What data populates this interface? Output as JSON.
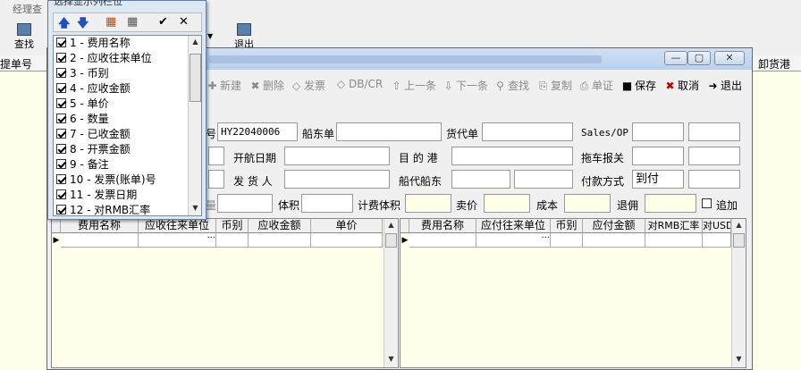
{
  "background": {
    "menu_label": "经理查",
    "toolbar": [
      {
        "label": "查找",
        "icon": "binoculars-icon"
      },
      {
        "label": "退出",
        "icon": "exit-door-icon"
      }
    ],
    "column_headers": [
      "提单号",
      "卸货港"
    ]
  },
  "popup": {
    "title": "选择显示列栏位",
    "toolbar_icons": [
      "move-up-icon",
      "move-down-icon",
      "palette-icon",
      "grid-icon",
      "ok-icon",
      "close-icon"
    ],
    "glyphs": {
      "up": "🡅",
      "down": "🡇",
      "palette": "▦",
      "grid": "▦",
      "ok": "✔",
      "close": "✕"
    },
    "items": [
      "1 - 费用名称",
      "2 - 应收往来单位",
      "3 - 币别",
      "4 - 应收金额",
      "5 - 单价",
      "6 - 数量",
      "7 - 已收金额",
      "8 - 开票金额",
      "9 - 备注",
      "10 - 发票(账单)号",
      "11 - 发票日期",
      "12 - 对RMB汇率"
    ]
  },
  "window": {
    "controls": {
      "minimize": "—",
      "maximize": "▢",
      "close": "✕"
    },
    "toolbar": [
      {
        "label": "新建",
        "glyph": "✚",
        "enabled": false
      },
      {
        "label": "删除",
        "glyph": "✖",
        "enabled": false
      },
      {
        "label": "发票",
        "glyph": "◇",
        "enabled": false
      },
      {
        "label": "DB/CR",
        "glyph": "◇",
        "enabled": false
      },
      {
        "label": "上一条",
        "glyph": "⇧",
        "enabled": false
      },
      {
        "label": "下一条",
        "glyph": "⇩",
        "enabled": false
      },
      {
        "label": "查找",
        "glyph": "⚲",
        "enabled": false
      },
      {
        "label": "复制",
        "glyph": "⎘",
        "enabled": false
      },
      {
        "label": "单证",
        "glyph": "⎙",
        "enabled": false
      },
      {
        "label": "保存",
        "glyph": "■",
        "enabled": true
      },
      {
        "label": "取消",
        "glyph": "✖",
        "enabled": true
      },
      {
        "label": "退出",
        "glyph": "➜",
        "enabled": true
      }
    ],
    "form": {
      "row1": {
        "id_label_tail": "号",
        "id_value": "HY22040006",
        "ship_order_label": "船东单",
        "ship_order_value": "",
        "forwarder_label": "货代单",
        "forwarder_value": "",
        "salesop_label": "Sales/OP",
        "salesop_value1": "",
        "salesop_value2": ""
      },
      "row2": {
        "sail_date_label": "开航日期",
        "sail_date_value": "",
        "dest_port_label": "目 的 港",
        "dest_port_value": "",
        "tow_customs_label": "拖车报关",
        "tow_customs_value1": "",
        "tow_customs_value2": ""
      },
      "row3": {
        "shipper_label": "发 货 人",
        "shipper_value": "",
        "ship_agent_label": "船代船东",
        "ship_agent_value1": "",
        "ship_agent_value2": "",
        "payment_label": "付款方式",
        "payment_value": "到付",
        "payment_extra": ""
      },
      "row4": {
        "weight_label_tail": "量",
        "weight_value": "",
        "volume_label": "体积",
        "volume_value": "",
        "charge_volume_label": "计费体积",
        "charge_volume_value": "",
        "sell_price_label": "卖价",
        "sell_price_value": "",
        "cost_label": "成本",
        "cost_value": "",
        "refund_label": "退佣",
        "refund_value": "",
        "append_label": "追加",
        "append_checked": false
      }
    },
    "left_grid": {
      "columns": [
        "费用名称",
        "应收往来单位",
        "币别",
        "应收金额",
        "单价"
      ],
      "ellipsis": "···"
    },
    "right_grid": {
      "columns": [
        "费用名称",
        "应付往来单位",
        "币别",
        "应付金额",
        "对RMB汇率",
        "对USD"
      ],
      "ellipsis": "···"
    }
  }
}
